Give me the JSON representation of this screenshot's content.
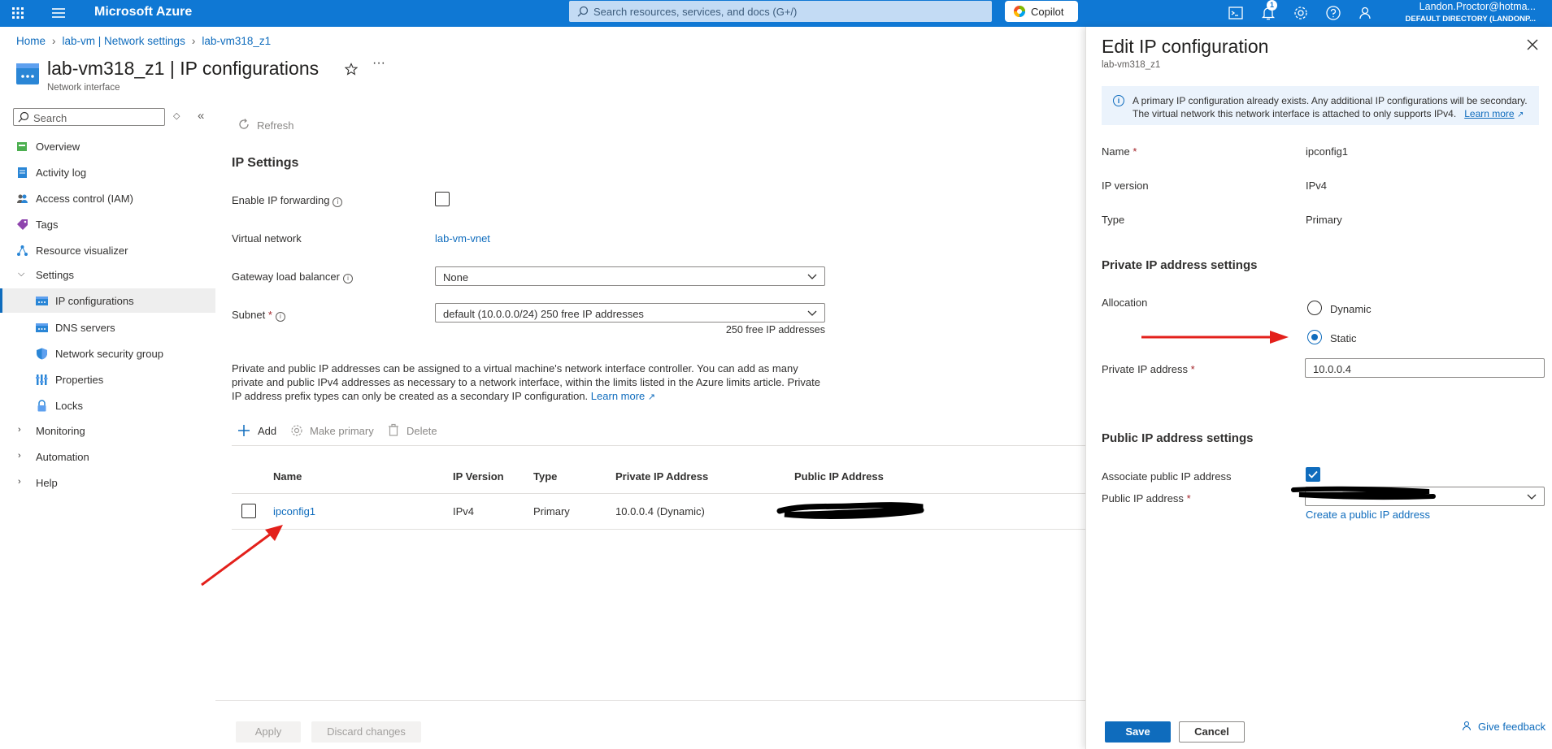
{
  "topbar": {
    "brand": "Microsoft Azure",
    "search_placeholder": "Search resources, services, and docs (G+/)",
    "copilot_label": "Copilot",
    "notification_count": "1",
    "user_name": "Landon.Proctor@hotma...",
    "user_directory": "DEFAULT DIRECTORY (LANDONP..."
  },
  "breadcrumb": {
    "home": "Home",
    "parent": "lab-vm | Network settings",
    "current": "lab-vm318_z1"
  },
  "header": {
    "title": "lab-vm318_z1 | IP configurations",
    "subtitle": "Network interface"
  },
  "sidebar": {
    "search_placeholder": "Search",
    "items": [
      {
        "label": "Overview"
      },
      {
        "label": "Activity log"
      },
      {
        "label": "Access control (IAM)"
      },
      {
        "label": "Tags"
      },
      {
        "label": "Resource visualizer"
      },
      {
        "label": "Settings"
      },
      {
        "label": "IP configurations"
      },
      {
        "label": "DNS servers"
      },
      {
        "label": "Network security group"
      },
      {
        "label": "Properties"
      },
      {
        "label": "Locks"
      },
      {
        "label": "Monitoring"
      },
      {
        "label": "Automation"
      },
      {
        "label": "Help"
      }
    ]
  },
  "main": {
    "refresh_label": "Refresh",
    "section_title": "IP Settings",
    "ip_forwarding_label": "Enable IP forwarding",
    "vnet_label": "Virtual network",
    "vnet_value": "lab-vm-vnet",
    "gateway_label": "Gateway load balancer",
    "gateway_value": "None",
    "subnet_label": "Subnet",
    "subnet_value": "default (10.0.0.0/24) 250 free IP addresses",
    "subnet_hint": "250 free IP addresses",
    "description_1": "Private and public IP addresses can be assigned to a virtual machine's network interface controller. You can add as many",
    "description_2": "private and public IPv4 addresses as necessary to a network interface, within the limits listed in the Azure limits article. Private",
    "description_3": "IP address prefix types can only be created as a secondary IP configuration.",
    "learn_more": "Learn more",
    "add_label": "Add",
    "make_primary_label": "Make primary",
    "delete_label": "Delete",
    "table": {
      "headers": [
        "Name",
        "IP Version",
        "Type",
        "Private IP Address",
        "Public IP Address"
      ],
      "rows": [
        {
          "name": "ipconfig1",
          "version": "IPv4",
          "type": "Primary",
          "private_ip": "10.0.0.4 (Dynamic)"
        }
      ]
    },
    "apply_label": "Apply",
    "discard_label": "Discard changes"
  },
  "panel": {
    "title": "Edit IP configuration",
    "subtitle": "lab-vm318_z1",
    "info_line1": "A primary IP configuration already exists. Any additional IP configurations will be secondary.",
    "info_line2": "The virtual network this network interface is attached to only supports IPv4.",
    "info_learn_more": "Learn more",
    "name_label": "Name",
    "name_value": "ipconfig1",
    "ipversion_label": "IP version",
    "ipversion_value": "IPv4",
    "type_label": "Type",
    "type_value": "Primary",
    "private_section": "Private IP address settings",
    "allocation_label": "Allocation",
    "allocation_dynamic": "Dynamic",
    "allocation_static": "Static",
    "allocation_selected": "Static",
    "private_ip_label": "Private IP address",
    "private_ip_value": "10.0.0.4",
    "public_section": "Public IP address settings",
    "associate_label": "Associate public IP address",
    "associate_checked": true,
    "public_ip_label": "Public IP address",
    "create_public_ip": "Create a public IP address",
    "save_label": "Save",
    "cancel_label": "Cancel",
    "feedback_label": "Give feedback"
  },
  "colors": {
    "azure_blue": "#0f78d4",
    "link_blue": "#0f6cbd",
    "annotation_red": "#e3201b"
  }
}
